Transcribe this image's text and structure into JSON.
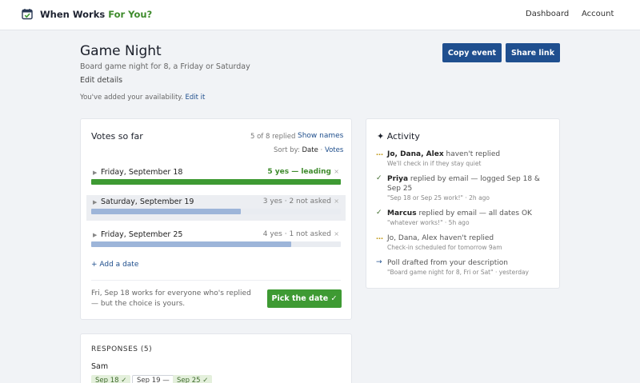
{
  "header": {
    "brand_prefix": "When Works ",
    "brand_accent": "For You?",
    "nav": [
      "Dashboard",
      "Account"
    ]
  },
  "event": {
    "title": "Game Night",
    "subtitle": "Board game night for 8, a Friday or Saturday",
    "edit_details": "Edit details",
    "availability_note": "You've added your availability.",
    "edit_it": "Edit it",
    "copy_event": "Copy event",
    "share_link": "Share link"
  },
  "votes": {
    "title": "Votes so far",
    "replied": "5 of 8 replied",
    "show_names": "Show names",
    "sort_by": "Sort by:",
    "sort_current": "Date",
    "sort_sep": "·",
    "sort_alt": "Votes",
    "dates": [
      {
        "label": "Friday, September 18",
        "status": "5 yes — leading",
        "fraction": 1.0,
        "color": "#3e9a33",
        "leading": true
      },
      {
        "label": "Saturday, September 19",
        "status": "3 yes · 2 not asked",
        "fraction": 0.6,
        "color": "#9db5d9",
        "leading": false
      },
      {
        "label": "Friday, September 25",
        "status": "4 yes · 1 not asked",
        "fraction": 0.8,
        "color": "#9db5d9",
        "leading": false
      }
    ],
    "remove_glyph": "×",
    "caret_glyph": "▶",
    "add_date": "+ Add a date",
    "pick_note": "Fri, Sep 18 works for everyone who's replied — but the choice is yours.",
    "pick_button": "Pick the date ✓"
  },
  "responses": {
    "title": "RESPONSES (5)",
    "first_name": "Sam",
    "chips": [
      {
        "label": "Sep 18 ✓",
        "kind": "yes"
      },
      {
        "label": "Sep 19 —",
        "kind": "no"
      },
      {
        "label": "Sep 25 ✓",
        "kind": "yes"
      }
    ]
  },
  "activity": {
    "title": "Activity",
    "title_icon": "✦",
    "items": [
      {
        "icon": "…",
        "icon_kind": "dots",
        "bold": "Jo, Dana, Alex",
        "text": " haven't replied",
        "sub": "We'll check in if they stay quiet"
      },
      {
        "icon": "✓",
        "icon_kind": "check",
        "bold": "Priya",
        "text": " replied by email — logged Sep 18 & Sep 25",
        "sub": "\"Sep 18 or Sep 25 work!\" · 2h ago"
      },
      {
        "icon": "✓",
        "icon_kind": "check",
        "bold": "Marcus",
        "text": " replied by email — all dates OK",
        "sub": "\"whatever works!\" · 5h ago"
      },
      {
        "icon": "…",
        "icon_kind": "dots",
        "bold": "",
        "text": "Jo, Dana, Alex haven't replied",
        "sub": "Check-in scheduled for tomorrow 9am"
      },
      {
        "icon": "→",
        "icon_kind": "arrow",
        "bold": "",
        "text": "Poll drafted from your description",
        "sub": "\"Board game night for 8, Fri or Sat\" · yesterday"
      }
    ]
  }
}
